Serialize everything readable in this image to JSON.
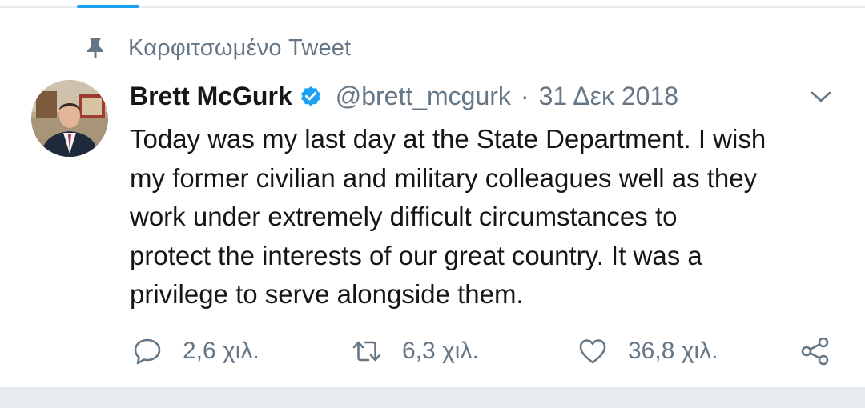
{
  "pinned": {
    "label": "Καρφιτσωμένο Tweet",
    "icon": "pin-icon"
  },
  "tweet": {
    "author": {
      "display_name": "Brett McGurk",
      "handle": "@brett_mcgurk",
      "verified": true,
      "avatar": "avatar-photo"
    },
    "separator": "·",
    "date": "31 Δεκ 2018",
    "text_lines": [
      "Today was my last day at the State Department. I wish",
      "my former civilian and military colleagues well as they",
      "work under extremely difficult circumstances to",
      "protect the interests of our great country. It was a",
      "privilege to serve alongside them."
    ],
    "actions": {
      "replies": {
        "count": "2,6 χιλ.",
        "icon": "reply-icon"
      },
      "retweets": {
        "count": "6,3 χιλ.",
        "icon": "retweet-icon"
      },
      "likes": {
        "count": "36,8 χιλ.",
        "icon": "heart-icon"
      },
      "share": {
        "icon": "share-icon"
      }
    }
  },
  "colors": {
    "accent": "#1da1f2",
    "text_primary": "#14171a",
    "text_secondary": "#657786",
    "divider": "#e6ecf0"
  }
}
